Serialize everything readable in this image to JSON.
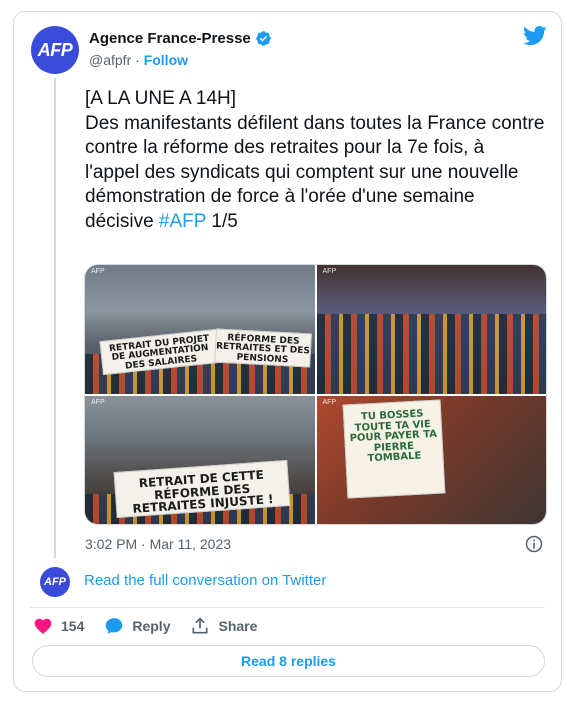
{
  "author": {
    "avatar_text": "AFP",
    "display_name": "Agence France-Presse",
    "handle": "@afpfr",
    "separator": "·",
    "follow_label": "Follow"
  },
  "tweet": {
    "lines": [
      "[A LA UNE A 14H]",
      "Des manifestants défilent dans toutes la France contre",
      "contre la réforme des retraites pour la 7e fois, à",
      "l'appel des syndicats qui comptent sur une nouvelle",
      "démonstration de force à l'orée d'une semaine",
      "décisive "
    ],
    "hashtag": "#AFP",
    "suffix": " 1/5"
  },
  "media": {
    "photos": [
      {
        "credit": "AFP",
        "signs": [
          "RETRAIT DU PROJET DE AUGMENTATION DES SALAIRES",
          "RÉFORME DES RETRAITES ET DES PENSIONS"
        ]
      },
      {
        "credit": "AFP",
        "signs": []
      },
      {
        "credit": "AFP",
        "signs": [
          "RETRAIT DE CETTE RÉFORME DES RETRAITES INJUSTE !"
        ]
      },
      {
        "credit": "AFP",
        "signs": [
          "TU BOSSES TOUTE TA VIE POUR PAYER TA PIERRE TOMBALE"
        ]
      }
    ]
  },
  "timestamp": "3:02 PM · Mar 11, 2023",
  "conversation_link": "Read the full conversation on Twitter",
  "actions": {
    "like_count": "154",
    "reply_label": "Reply",
    "share_label": "Share"
  },
  "read_replies_label": "Read 8 replies",
  "colors": {
    "accent": "#1d9bf0",
    "avatar_bg": "#3b4bd9",
    "like": "#f91880",
    "muted_text": "#536471"
  }
}
